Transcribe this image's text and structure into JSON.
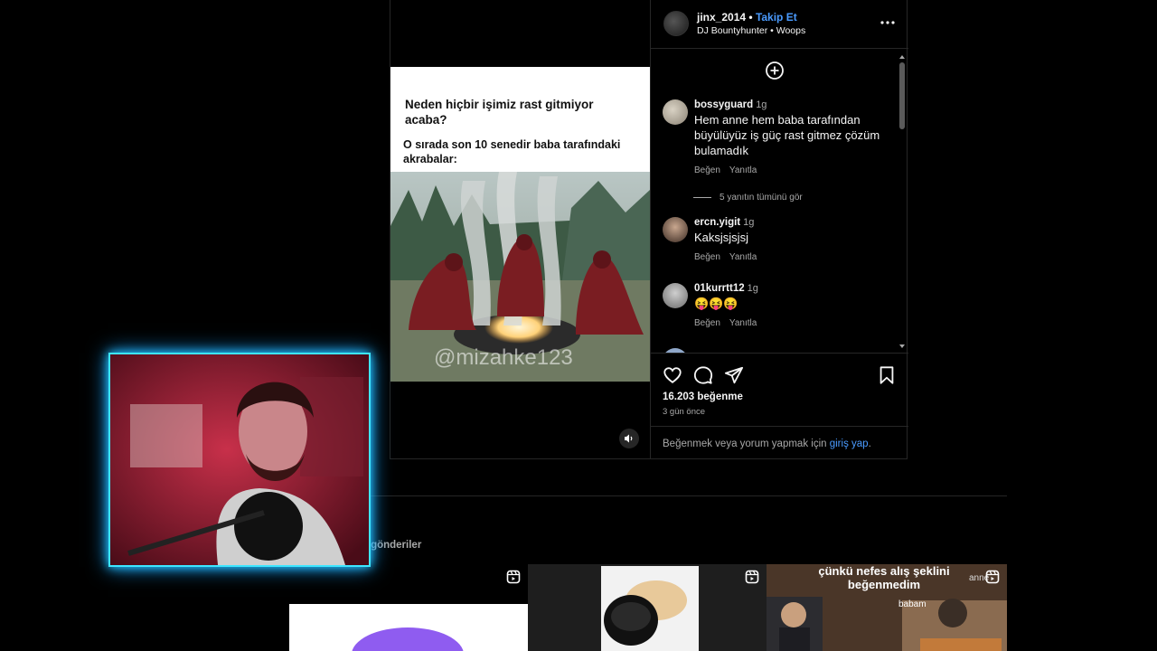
{
  "post": {
    "author": {
      "username": "jinx_2014",
      "separator": "•",
      "follow_label": "Takip Et",
      "audio": "DJ Bountyhunter • Woops"
    },
    "meme": {
      "question": "Neden hiçbir işimiz rast gitmiyor acaba?",
      "answer": "O sırada son 10 senedir baba tarafındaki akrabalar:",
      "watermark": "@mizahke123"
    },
    "comments": [
      {
        "user": "bossyguard",
        "time": "1g",
        "text": "Hem anne hem baba tarafından büyülüyüz iş güç rast gitmez çözüm bulamadık",
        "like": "Beğen",
        "reply": "Yanıtla"
      },
      {
        "user": "ercn.yigit",
        "time": "1g",
        "text": "Kaksjsjsjsj",
        "like": "Beğen",
        "reply": "Yanıtla"
      },
      {
        "user": "01kurrtt12",
        "time": "1g",
        "text": "😝😝😝",
        "like": "Beğen",
        "reply": "Yanıtla"
      }
    ],
    "view_replies": "5 yanıtın tümünü gör",
    "likes": "16.203 beğenme",
    "posted_ago": "3 gün önce",
    "login_prompt": "Beğenmek veya yorum yapmak için",
    "login_link": "giriş yap",
    "login_suffix": "."
  },
  "more_posts_label": "er gönderiler",
  "thumbnails": [
    {
      "caption": ""
    },
    {
      "caption": ""
    },
    {
      "caption": "çünkü nefes alış şeklini beğenmedim",
      "tag1": "babam",
      "tag2": "anne"
    }
  ],
  "colors": {
    "link": "#4a9bff",
    "cam_border": "#3ee6ff",
    "divider": "#262626"
  },
  "icons": [
    "more-icon",
    "add-comment-icon",
    "heart-icon",
    "comment-icon",
    "share-icon",
    "bookmark-icon",
    "sound-icon",
    "reel-icon"
  ]
}
